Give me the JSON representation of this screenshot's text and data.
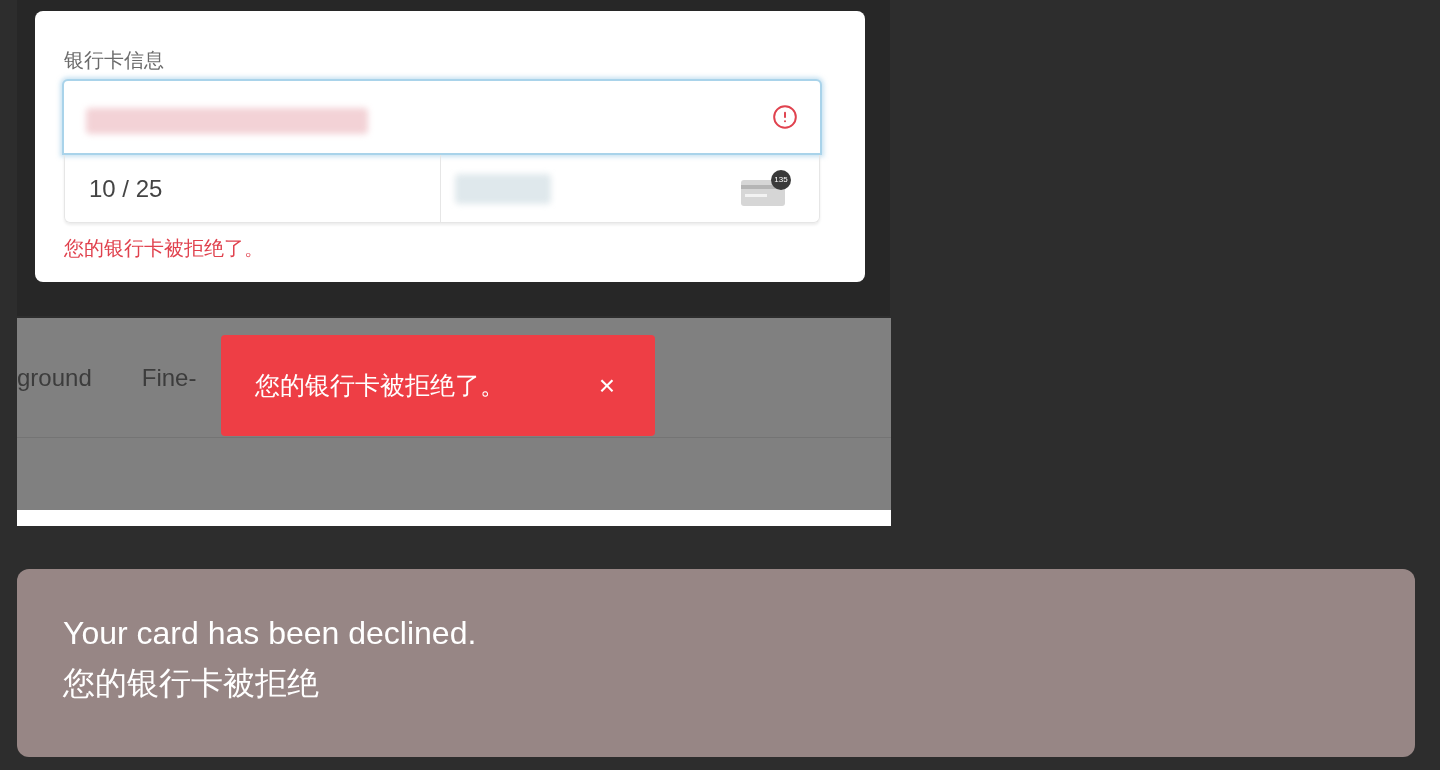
{
  "card_form": {
    "label": "银行卡信息",
    "card_number": {
      "focused": true,
      "error": true
    },
    "expiry": {
      "value": "10 / 25"
    },
    "cvc": {
      "badge": "135"
    },
    "error_message": "您的银行卡被拒绝了。"
  },
  "tabs": [
    {
      "label": "ground"
    },
    {
      "label": "Fine-"
    }
  ],
  "toast": {
    "message": "您的银行卡被拒绝了。",
    "close": "×"
  },
  "caption": {
    "lines": [
      "Your card has been declined.",
      "您的银行卡被拒绝"
    ]
  }
}
